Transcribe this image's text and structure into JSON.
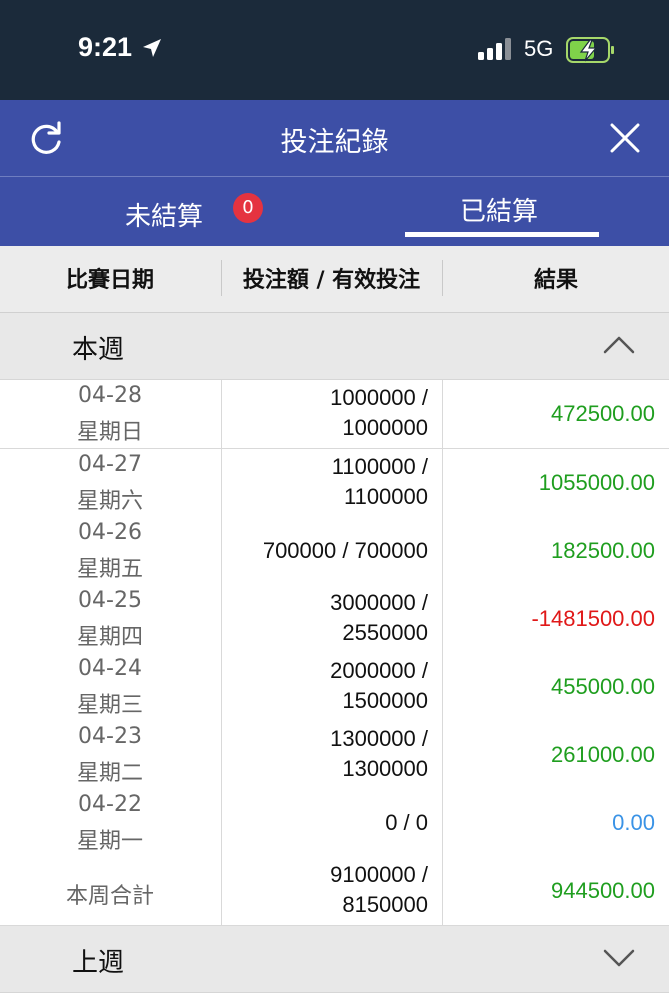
{
  "status_bar": {
    "time": "9:21",
    "network": "5G"
  },
  "header": {
    "title": "投注紀錄"
  },
  "tabs": [
    {
      "label": "未結算",
      "badge": "0"
    },
    {
      "label": "已結算"
    }
  ],
  "table": {
    "columns": [
      "比賽日期",
      "投注額 / 有效投注",
      "結果"
    ],
    "sections": [
      {
        "label": "本週",
        "rows": [
          {
            "date": "04-28",
            "weekday": "星期日",
            "bet": "1000000 /",
            "valid": "1000000",
            "result": "472500.00",
            "type": "pos"
          },
          {
            "date": "04-27",
            "weekday": "星期六",
            "bet": "1100000 /",
            "valid": "1100000",
            "result": "1055000.00",
            "type": "pos"
          },
          {
            "date": "04-26",
            "weekday": "星期五",
            "bet_single": "700000 / 700000",
            "result": "182500.00",
            "type": "pos"
          },
          {
            "date": "04-25",
            "weekday": "星期四",
            "bet": "3000000 /",
            "valid": "2550000",
            "result": "-1481500.00",
            "type": "neg"
          },
          {
            "date": "04-24",
            "weekday": "星期三",
            "bet": "2000000 /",
            "valid": "1500000",
            "result": "455000.00",
            "type": "pos"
          },
          {
            "date": "04-23",
            "weekday": "星期二",
            "bet": "1300000 /",
            "valid": "1300000",
            "result": "261000.00",
            "type": "pos"
          },
          {
            "date": "04-22",
            "weekday": "星期一",
            "bet_single": "0 / 0",
            "result": "0.00",
            "type": "zero"
          }
        ],
        "total": {
          "label": "本周合計",
          "bet": "9100000 /",
          "valid": "8150000",
          "result": "944500.00"
        }
      },
      {
        "label": "上週"
      }
    ]
  },
  "colors": {
    "header_blue": "#3d4fa6",
    "positive": "#1f9e1f",
    "negative": "#e01818",
    "zero": "#3a93e6",
    "badge": "#e53340"
  }
}
